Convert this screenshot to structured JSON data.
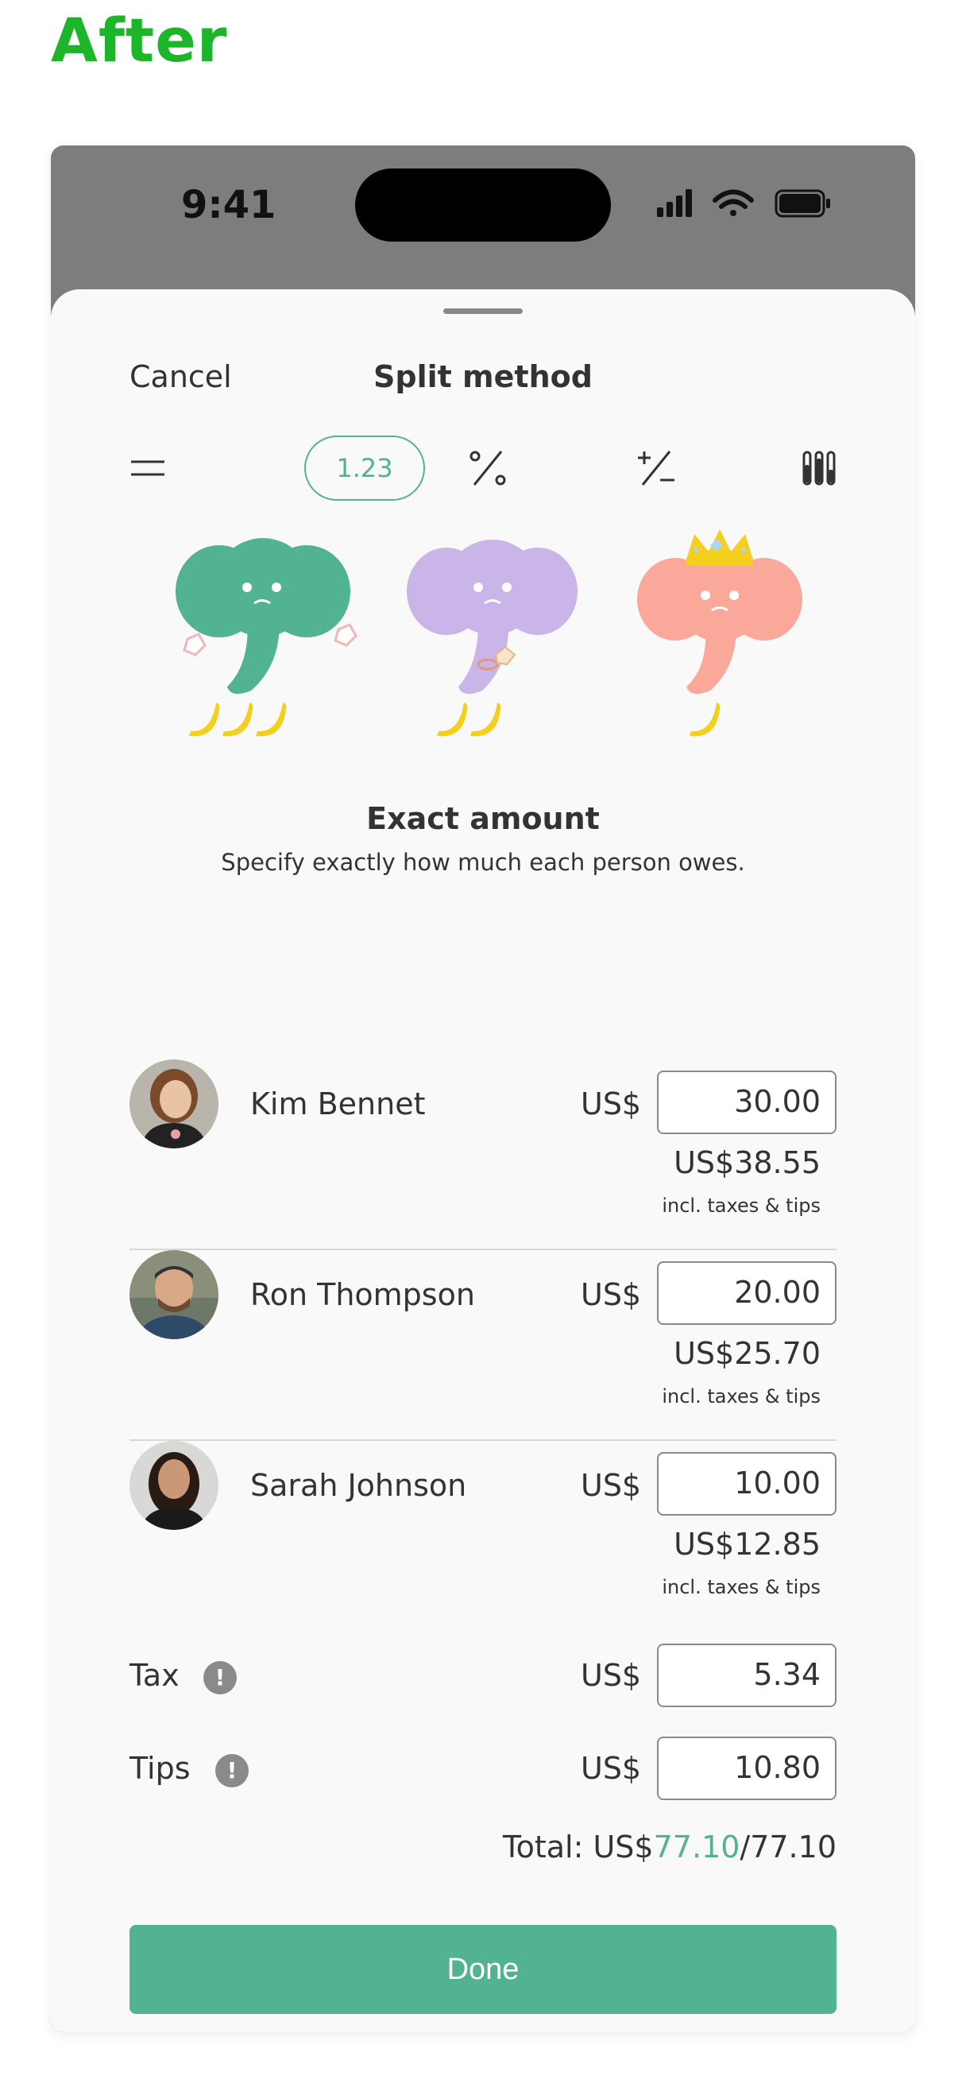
{
  "page_label": "After",
  "status_bar": {
    "time": "9:41"
  },
  "sheet": {
    "cancel_label": "Cancel",
    "title": "Split method",
    "methods": [
      {
        "name": "equal-split-icon"
      },
      {
        "name": "exact-amount",
        "label": "1.23",
        "selected": true
      },
      {
        "name": "percent-icon"
      },
      {
        "name": "adjustment-icon"
      },
      {
        "name": "shares-icon"
      }
    ],
    "mascots": [
      {
        "color": "#52b393",
        "bananas": 3,
        "accessory": "earrings"
      },
      {
        "color": "#c9b5e8",
        "bananas": 2,
        "accessory": "ring"
      },
      {
        "color": "#f9a89a",
        "bananas": 1,
        "accessory": "crown"
      }
    ],
    "description_title": "Exact amount",
    "description_subtitle": "Specify exactly how much each person owes.",
    "people": [
      {
        "name": "Kim Bennet",
        "currency": "US$",
        "amount": "30.00",
        "incl_total": "US$38.55",
        "incl_note": "incl. taxes & tips"
      },
      {
        "name": "Ron Thompson",
        "currency": "US$",
        "amount": "20.00",
        "incl_total": "US$25.70",
        "incl_note": "incl. taxes & tips"
      },
      {
        "name": "Sarah Johnson",
        "currency": "US$",
        "amount": "10.00",
        "incl_total": "US$12.85",
        "incl_note": "incl. taxes & tips"
      }
    ],
    "tax": {
      "label": "Tax",
      "info_glyph": "!",
      "currency": "US$",
      "amount": "5.34"
    },
    "tips": {
      "label": "Tips",
      "info_glyph": "!",
      "currency": "US$",
      "amount": "10.80"
    },
    "total": {
      "prefix": "Total: US$",
      "assigned": "77.10",
      "separator": "/",
      "target": "77.10"
    },
    "done_label": "Done"
  },
  "colors": {
    "accent": "#52b393",
    "after_label": "#1db52a",
    "banana": "#f5cf1e"
  }
}
